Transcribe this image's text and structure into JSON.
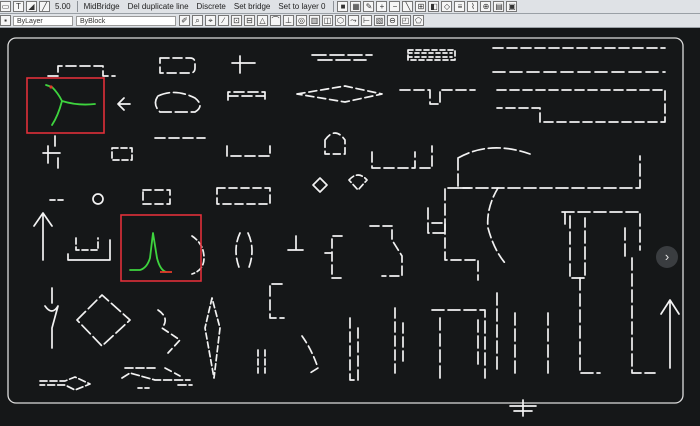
{
  "toolbar": {
    "zoom_value": "5.00",
    "commands": [
      "MidBridge",
      "Del duplicate line",
      "Discrete",
      "Set bridge",
      "Set to layer 0"
    ]
  },
  "properties": {
    "layer": "ByLayer",
    "linetype": "ByBlock"
  },
  "colors": {
    "toolbar_bg": "#dfe2e6",
    "canvas_bg": "#151718",
    "geometry": "#f2f2f2",
    "highlight_box": "#e0303a",
    "selected_curve": "#3ed43e",
    "endpoint_marker": "#e03a2a"
  },
  "icons": [
    "shape-tool-icon",
    "text-icon",
    "polygon-icon",
    "line-icon",
    "zoom-in-icon",
    "zoom-out-icon",
    "grid-icon",
    "pen-icon",
    "arrow-right-icon"
  ]
}
